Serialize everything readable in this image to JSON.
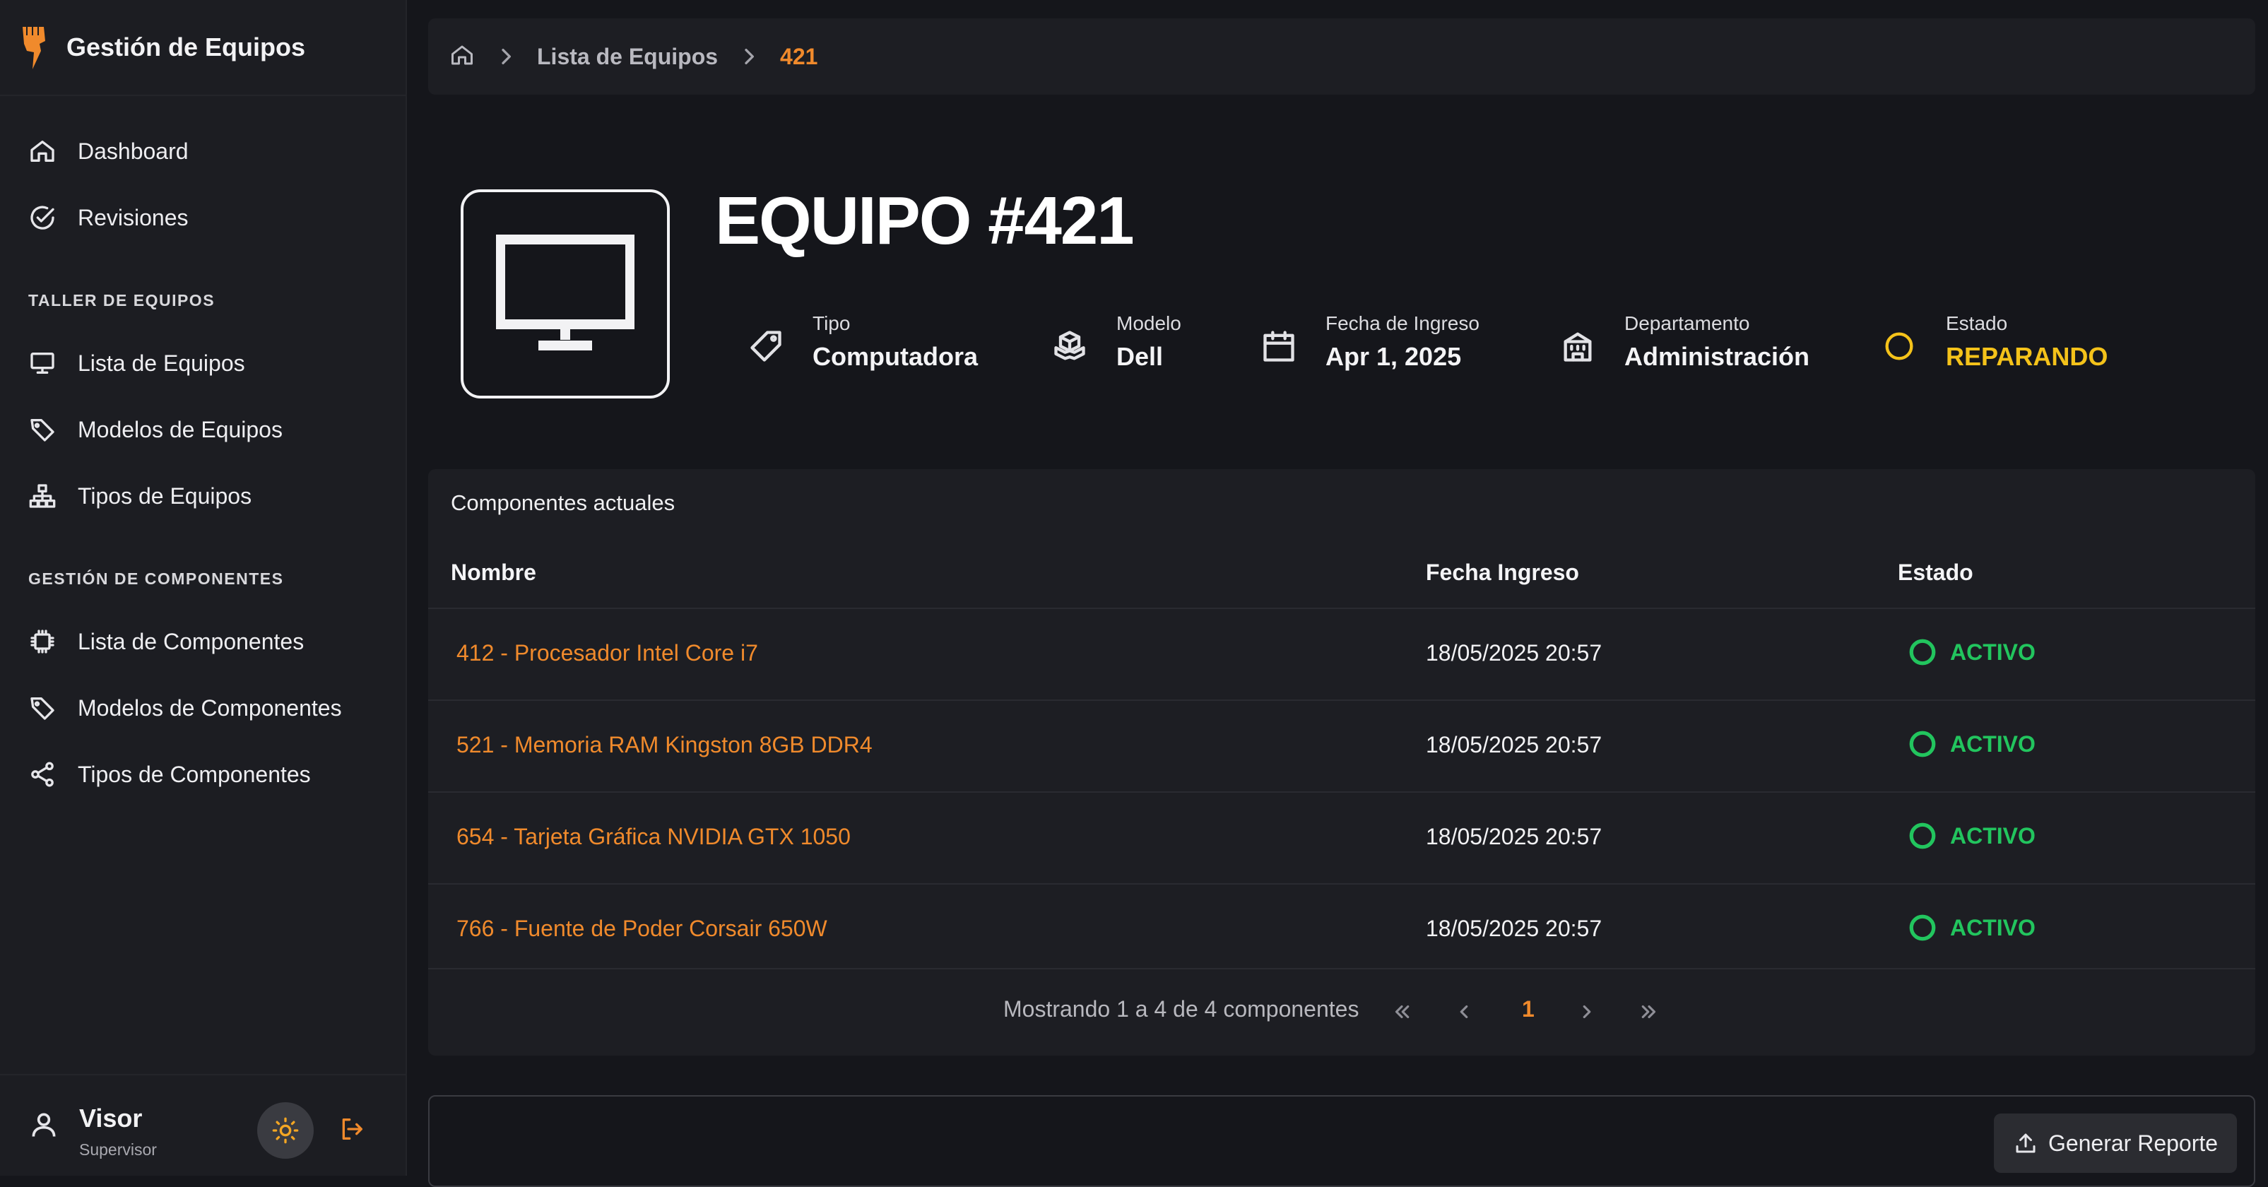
{
  "app": {
    "title": "Gestión de Equipos"
  },
  "sidebar": {
    "main_items": [
      {
        "label": "Dashboard",
        "icon": "home-icon"
      },
      {
        "label": "Revisiones",
        "icon": "check-circle-icon"
      }
    ],
    "section_taller": {
      "title": "TALLER DE EQUIPOS",
      "items": [
        {
          "label": "Lista de Equipos",
          "icon": "monitor-icon"
        },
        {
          "label": "Modelos de Equipos",
          "icon": "tag-icon"
        },
        {
          "label": "Tipos de Equipos",
          "icon": "hierarchy-icon"
        }
      ]
    },
    "section_componentes": {
      "title": "GESTIÓN DE COMPONENTES",
      "items": [
        {
          "label": "Lista de Componentes",
          "icon": "chip-icon"
        },
        {
          "label": "Modelos de Componentes",
          "icon": "tag-icon"
        },
        {
          "label": "Tipos de Componentes",
          "icon": "share-icon"
        }
      ]
    },
    "user": {
      "name": "Visor",
      "role": "Supervisor"
    }
  },
  "breadcrumb": {
    "home_icon": "home-icon",
    "link": "Lista de Equipos",
    "current": "421"
  },
  "equipment": {
    "title": "EQUIPO #421",
    "icon": "monitor-icon",
    "info": {
      "tipo": {
        "label": "Tipo",
        "value": "Computadora"
      },
      "modelo": {
        "label": "Modelo",
        "value": "Dell"
      },
      "fecha": {
        "label": "Fecha de Ingreso",
        "value": "Apr 1, 2025"
      },
      "departamento": {
        "label": "Departamento",
        "value": "Administración"
      },
      "estado": {
        "label": "Estado",
        "value": "REPARANDO"
      }
    }
  },
  "components": {
    "title": "Componentes actuales",
    "columns": {
      "name": "Nombre",
      "date": "Fecha Ingreso",
      "state": "Estado"
    },
    "rows": [
      {
        "name": "412 - Procesador Intel Core i7",
        "date": "18/05/2025 20:57",
        "state": "ACTIVO"
      },
      {
        "name": "521 - Memoria RAM Kingston 8GB DDR4",
        "date": "18/05/2025 20:57",
        "state": "ACTIVO"
      },
      {
        "name": "654 - Tarjeta Gráfica NVIDIA GTX 1050",
        "date": "18/05/2025 20:57",
        "state": "ACTIVO"
      },
      {
        "name": "766 - Fuente de Poder Corsair 650W",
        "date": "18/05/2025 20:57",
        "state": "ACTIVO"
      }
    ],
    "pagination": {
      "summary": "Mostrando 1 a 4 de 4 componentes",
      "current_page": "1"
    }
  },
  "report": {
    "button_label": "Generar Reporte"
  },
  "colors": {
    "accent": "#f08a2c",
    "status_repairing": "#f4c21a",
    "status_active": "#22c55e",
    "background": "#15161b",
    "panel": "#1d1e23"
  }
}
